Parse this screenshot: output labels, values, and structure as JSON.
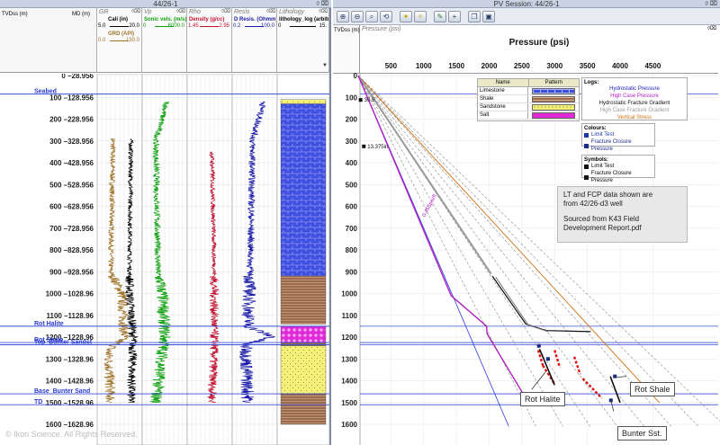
{
  "left_panel": {
    "title": "44/26-1",
    "depth_header": {
      "tvd": "TVDss (m)",
      "md": "MD (m)"
    },
    "tracks": [
      {
        "id": "gr",
        "name": "GR",
        "curves": [
          {
            "label": "Cali (in)",
            "min": "5.0",
            "max": "20.0",
            "color": "#000000"
          },
          {
            "label": "GRD (API)",
            "min": "0.0",
            "max": "150.0",
            "color": "#a0742a"
          }
        ]
      },
      {
        "id": "vp",
        "name": "Vp",
        "curves": [
          {
            "label": "Sonic vels. (m/s)",
            "min": "0",
            "max": "6000.0",
            "color": "#10a010"
          }
        ]
      },
      {
        "id": "rho",
        "name": "Rho",
        "curves": [
          {
            "label": "Density (g/cc)",
            "min": "1.45",
            "max": "2.95",
            "color": "#c01030"
          }
        ]
      },
      {
        "id": "res",
        "name": "Resis",
        "curves": [
          {
            "label": "D Resis. (Ohmm)",
            "min": "0.2",
            "max": "100.0",
            "color": "#1a1aa8"
          }
        ]
      },
      {
        "id": "lith",
        "name": "Lithology",
        "curves": [
          {
            "label": "lithology_log (arbitrary)",
            "min": "0",
            "max": "15.",
            "color": "#000000"
          }
        ]
      }
    ],
    "depth_labels": [
      {
        "tvd": "0",
        "md": "28.956"
      },
      {
        "tvd": "100",
        "md": "128.956"
      },
      {
        "tvd": "200",
        "md": "228.956"
      },
      {
        "tvd": "300",
        "md": "328.956"
      },
      {
        "tvd": "400",
        "md": "428.956"
      },
      {
        "tvd": "500",
        "md": "528.956"
      },
      {
        "tvd": "600",
        "md": "628.956"
      },
      {
        "tvd": "700",
        "md": "728.956"
      },
      {
        "tvd": "800",
        "md": "828.956"
      },
      {
        "tvd": "900",
        "md": "928.956"
      },
      {
        "tvd": "1000",
        "md": "1028.96"
      },
      {
        "tvd": "1100",
        "md": "1128.96"
      },
      {
        "tvd": "1200",
        "md": "1228.96"
      },
      {
        "tvd": "1300",
        "md": "1328.96"
      },
      {
        "tvd": "1400",
        "md": "1428.96"
      },
      {
        "tvd": "1500",
        "md": "1528.96"
      },
      {
        "tvd": "1600",
        "md": "1628.96"
      }
    ],
    "zones": [
      {
        "name": "Seabed",
        "tvd": 85
      },
      {
        "name": "Rot Halite",
        "tvd": 1150
      },
      {
        "name": "Rot Shale",
        "tvd": 1225
      },
      {
        "name": "Top_Bunter Sandst",
        "tvd": 1235
      },
      {
        "name": "Base_Bunter Sand",
        "tvd": 1460
      },
      {
        "name": "TD",
        "tvd": 1510
      }
    ],
    "lithology_column": [
      {
        "type": "Sandstone",
        "top": 110,
        "base": 130
      },
      {
        "type": "Limestone",
        "top": 130,
        "base": 920
      },
      {
        "type": "Shale",
        "top": 920,
        "base": 1140
      },
      {
        "type": "Salt",
        "top": 1150,
        "base": 1225
      },
      {
        "type": "Shale",
        "top": 1225,
        "base": 1240
      },
      {
        "type": "Sandstone",
        "top": 1240,
        "base": 1460
      },
      {
        "type": "Shale",
        "top": 1460,
        "base": 1600
      }
    ],
    "watermark": "© Ikon Science. All Rights Reserved."
  },
  "right_panel": {
    "title": "PV Session: 44/26-1",
    "toolbar_icons": [
      "zoom-in-icon",
      "zoom-out-icon",
      "zoom-box-icon",
      "zoom-reset-icon",
      "star-icon",
      "pointer-icon",
      "pen-icon",
      "plus-icon",
      "copy-icon",
      "save-icon"
    ],
    "track_header": {
      "tvd": "TVDss (m)",
      "name": "Pressure (psi)"
    },
    "pressure_ticks": [
      "500",
      "1000",
      "1500",
      "2000",
      "2500",
      "3000",
      "3500",
      "4000",
      "4500"
    ],
    "pressure_axis_title": "Pressure (psi)",
    "point_labels": [
      {
        "text": "30.5",
        "tvd": 112,
        "p": 50
      },
      {
        "text": "13.375in",
        "tvd": 325,
        "p": 100
      }
    ],
    "gradient_labels": [
      {
        "text": "0.465psi/ft",
        "tvd": 650,
        "p": 1020
      }
    ],
    "lithology_legend": {
      "headers": [
        "Name",
        "Pattern"
      ],
      "rows": [
        {
          "name": "Limestone",
          "pattern": "limestone"
        },
        {
          "name": "Shale",
          "pattern": "shale"
        },
        {
          "name": "Sandstone",
          "pattern": "sandstone"
        },
        {
          "name": "Salt",
          "pattern": "salt"
        }
      ]
    },
    "logs_legend": {
      "title": "Logs:",
      "items": [
        {
          "label": "Hydrostatic Pressure",
          "color": "#2020c0"
        },
        {
          "label": "High Case Pressure",
          "color": "#b020c0"
        },
        {
          "label": "Hydrostatic Fracture Gradient",
          "color": "#111111"
        },
        {
          "label": "High Case Fracture Gradient",
          "color": "#999999"
        },
        {
          "label": "Vertical Stress",
          "color": "#d07010"
        }
      ]
    },
    "colours_legend": {
      "title": "Colours:",
      "items": [
        {
          "label": "Limit Test",
          "color": "#1a3aa8"
        },
        {
          "label": "Fracture Closure Pressure",
          "color": "#1a2a88"
        }
      ]
    },
    "symbols_legend": {
      "title": "Symbols:",
      "items": [
        {
          "label": "Limit Test"
        },
        {
          "label": "Fracture Closure Pressure"
        }
      ]
    },
    "note_box": {
      "line1": "LT and FCP data shown are",
      "line2": "from 42/26-d3 well",
      "line3": "Sourced from K43 Field",
      "line4": "Development Report.pdf"
    },
    "callouts": [
      {
        "text": "Rot Halite"
      },
      {
        "text": "Rot Shale"
      },
      {
        "text": "Bunter Sst."
      }
    ],
    "series": {
      "hydrostatic": [
        [
          0,
          0
        ],
        [
          1610,
          2300
        ]
      ],
      "high_case": [
        [
          0,
          0
        ],
        [
          1010,
          1420
        ],
        [
          1150,
          1960
        ],
        [
          1185,
          1970
        ],
        [
          1500,
          2600
        ]
      ],
      "hydro_frac": [
        [
          920,
          2050
        ],
        [
          1140,
          2560
        ],
        [
          1170,
          2870
        ],
        [
          1175,
          3550
        ]
      ],
      "high_frac": [
        [
          0,
          0
        ],
        [
          910,
          2030
        ]
      ],
      "overburden": [
        [
          0,
          0
        ],
        [
          1500,
          4600
        ]
      ]
    }
  }
}
